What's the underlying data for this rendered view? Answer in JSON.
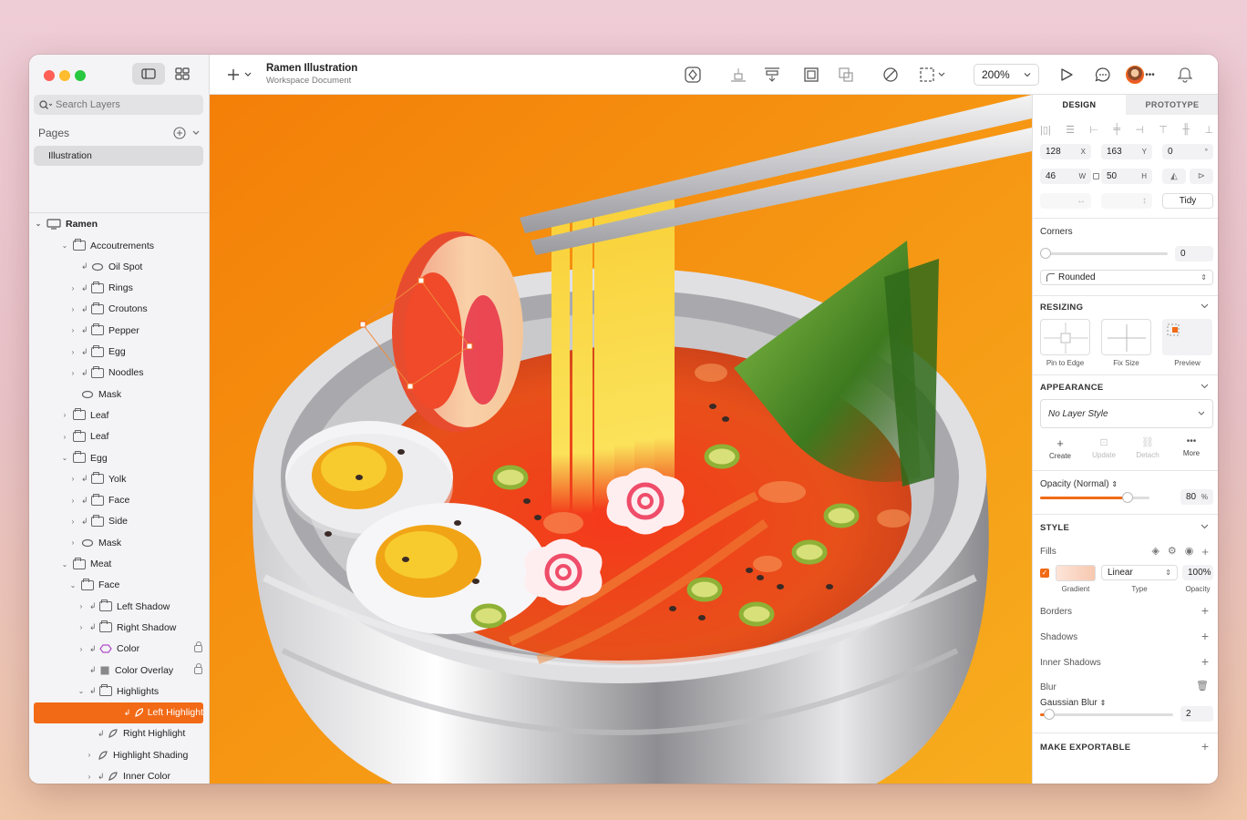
{
  "document": {
    "title": "Ramen Illustration",
    "subtitle": "Workspace Document"
  },
  "search": {
    "placeholder": "Search Layers"
  },
  "pages": {
    "header": "Pages",
    "items": [
      "Illustration"
    ]
  },
  "layers": [
    {
      "label": "Ramen",
      "indent": 0,
      "chev": "v",
      "icon": "artboard"
    },
    {
      "label": "Accoutrements",
      "indent": 1,
      "chev": "v",
      "icon": "folder"
    },
    {
      "label": "Oil Spot",
      "indent": 2,
      "chev": "",
      "mask": true,
      "icon": "oval"
    },
    {
      "label": "Rings",
      "indent": 2,
      "chev": ">",
      "mask": true,
      "icon": "folder"
    },
    {
      "label": "Croutons",
      "indent": 2,
      "chev": ">",
      "mask": true,
      "icon": "folder"
    },
    {
      "label": "Pepper",
      "indent": 2,
      "chev": ">",
      "mask": true,
      "icon": "folder"
    },
    {
      "label": "Egg",
      "indent": 2,
      "chev": ">",
      "mask": true,
      "icon": "folder"
    },
    {
      "label": "Noodles",
      "indent": 2,
      "chev": ">",
      "mask": true,
      "icon": "folder"
    },
    {
      "label": "Mask",
      "indent": 2,
      "chev": "",
      "icon": "oval"
    },
    {
      "label": "Leaf",
      "indent": 1,
      "chev": ">",
      "icon": "folder"
    },
    {
      "label": "Leaf",
      "indent": 1,
      "chev": ">",
      "icon": "folder"
    },
    {
      "label": "Egg",
      "indent": 1,
      "chev": "v",
      "icon": "folder"
    },
    {
      "label": "Yolk",
      "indent": 2,
      "chev": ">",
      "mask": true,
      "icon": "folder"
    },
    {
      "label": "Face",
      "indent": 2,
      "chev": ">",
      "mask": true,
      "icon": "folder"
    },
    {
      "label": "Side",
      "indent": 2,
      "chev": ">",
      "mask": true,
      "icon": "folder"
    },
    {
      "label": "Mask",
      "indent": 2,
      "chev": ">",
      "icon": "oval"
    },
    {
      "label": "Meat",
      "indent": 1,
      "chev": "v",
      "icon": "folder"
    },
    {
      "label": "Face",
      "indent": 2,
      "chev": "v",
      "icon": "folder"
    },
    {
      "label": "Left Shadow",
      "indent": 3,
      "chev": ">",
      "mask": true,
      "icon": "folder"
    },
    {
      "label": "Right Shadow",
      "indent": 3,
      "chev": ">",
      "mask": true,
      "icon": "folder"
    },
    {
      "label": "Color",
      "indent": 3,
      "chev": ">",
      "mask": true,
      "icon": "symbol",
      "locked": true
    },
    {
      "label": "Color Overlay",
      "indent": 3,
      "chev": "",
      "mask": true,
      "icon": "rect",
      "locked": true
    },
    {
      "label": "Highlights",
      "indent": 3,
      "chev": "v",
      "mask": true,
      "icon": "folder"
    },
    {
      "label": "Left Highlight",
      "indent": 4,
      "chev": "",
      "mask": true,
      "icon": "path",
      "selected": true
    },
    {
      "label": "Right Highlight",
      "indent": 4,
      "chev": "",
      "mask": true,
      "icon": "path"
    },
    {
      "label": "Highlight Shading",
      "indent": 4,
      "chev": ">",
      "icon": "path"
    },
    {
      "label": "Inner Color",
      "indent": 4,
      "chev": ">",
      "mask": true,
      "icon": "path"
    }
  ],
  "toolbar": {
    "zoom": "200%",
    "icons": [
      "insert-icon",
      "symbol-icon",
      "align-bottom-icon",
      "distribute-icon",
      "mask-icon",
      "scale-icon",
      "edit-path-icon",
      "transform-icon",
      "play-icon",
      "comment-icon",
      "avatar",
      "bell-icon"
    ]
  },
  "inspector": {
    "tabs": [
      "DESIGN",
      "PROTOTYPE"
    ],
    "x": "128",
    "x_label": "X",
    "y": "163",
    "y_label": "Y",
    "rotation": "0",
    "rotation_unit": "°",
    "w": "46",
    "w_label": "W",
    "h": "50",
    "h_label": "H",
    "tidy": "Tidy",
    "corners_label": "Corners",
    "corners_value": "0",
    "corner_style": "Rounded",
    "resizing_label": "RESIZING",
    "pin_label": "Pin to Edge",
    "fix_label": "Fix Size",
    "preview_label": "Preview",
    "appearance_label": "APPEARANCE",
    "layer_style": "No Layer Style",
    "style_actions": [
      "Create",
      "Update",
      "Detach",
      "More"
    ],
    "opacity_label": "Opacity (Normal)",
    "opacity_value": "80",
    "opacity_unit": "%",
    "opacity_level": 0.8,
    "style_label": "STYLE",
    "fills_label": "Fills",
    "fill_type": "Linear",
    "fill_opacity": "100%",
    "fill_sub": [
      "Gradient",
      "Type",
      "Opacity"
    ],
    "borders_label": "Borders",
    "shadows_label": "Shadows",
    "inner_shadows_label": "Inner Shadows",
    "blur_label": "Blur",
    "blur_type": "Gaussian Blur",
    "blur_value": "2",
    "blur_level": 0.04,
    "export_label": "MAKE EXPORTABLE"
  },
  "colors": {
    "accent": "#f26a16",
    "canvas": "#f6a217",
    "broth": "#e8501a"
  }
}
